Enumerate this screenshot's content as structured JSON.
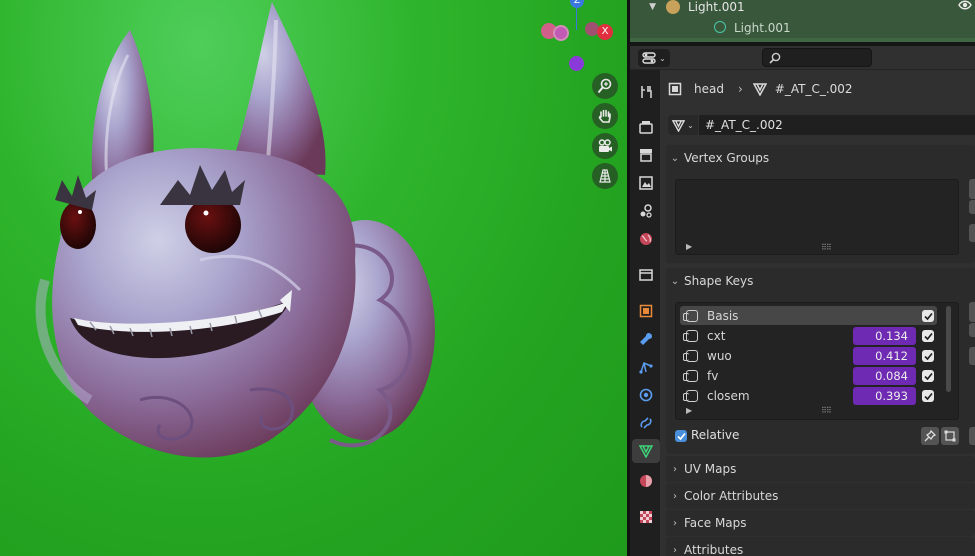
{
  "outliner": {
    "rows": [
      {
        "label": "Light.001",
        "icon": "light-bulb-icon"
      },
      {
        "label": "Light.001",
        "icon": "light-data-icon"
      }
    ]
  },
  "properties": {
    "breadcrumb": {
      "object": "head",
      "mesh": "#_AT_C_.002"
    },
    "mesh_name": "#_AT_C_.002",
    "tabs": [
      "tool-icon",
      "render-icon",
      "output-icon",
      "view-layer-icon",
      "scene-icon",
      "world-icon",
      "collection-icon",
      "object-icon",
      "modifier-icon",
      "particles-icon",
      "physics-icon",
      "constraints-icon",
      "mesh-data-icon",
      "material-icon",
      "texture-icon"
    ],
    "vertex_groups": {
      "title": "Vertex Groups"
    },
    "shape_keys": {
      "title": "Shape Keys",
      "keys": [
        {
          "name": "Basis",
          "value": "",
          "enabled": true
        },
        {
          "name": "cxt",
          "value": "0.134",
          "enabled": true
        },
        {
          "name": "wuo",
          "value": "0.412",
          "enabled": true
        },
        {
          "name": "fv",
          "value": "0.084",
          "enabled": true
        },
        {
          "name": "closem",
          "value": "0.393",
          "enabled": true
        }
      ],
      "relative_label": "Relative",
      "relative_checked": true
    },
    "collapsed_panels": [
      "UV Maps",
      "Color Attributes",
      "Face Maps",
      "Attributes"
    ]
  },
  "viewport": {
    "gizmo": {
      "z": "Z",
      "x": "X"
    },
    "nav_buttons": [
      "zoom-icon",
      "hand-pan-icon",
      "camera-icon",
      "grid-icon"
    ]
  },
  "colors": {
    "viewport_bg": "#23a320",
    "shape_key_value": "#6f2ab4",
    "selection": "#39573b"
  }
}
